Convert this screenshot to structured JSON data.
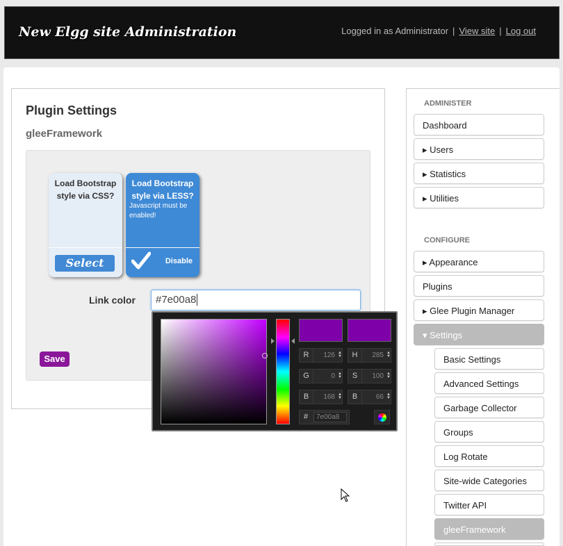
{
  "header": {
    "site_title": "New Elgg site Administration",
    "logged_in_text": "Logged in as Administrator",
    "separator": "|",
    "view_site": "View site",
    "logout": "Log out"
  },
  "main": {
    "title": "Plugin Settings",
    "plugin_name": "gleeFramework",
    "option_css": {
      "title": "Load Bootstrap style via CSS?",
      "button": "Select"
    },
    "option_less": {
      "title": "Load Bootstrap style via LESS?",
      "note": "Javascript must be enabled!",
      "button": "Disable"
    },
    "link_color_label": "Link color",
    "link_color_value": "#7e00a8",
    "save_label": "Save"
  },
  "color_picker": {
    "new_color": "#7e00a8",
    "current_color": "#7e00a8",
    "fields": {
      "r": {
        "label": "R",
        "value": "126"
      },
      "g": {
        "label": "G",
        "value": "0"
      },
      "b": {
        "label": "B",
        "value": "168"
      },
      "h": {
        "label": "H",
        "value": "285"
      },
      "s": {
        "label": "S",
        "value": "100"
      },
      "br": {
        "label": "B",
        "value": "66"
      }
    },
    "hex_label": "#",
    "hex_value": "7e00a8"
  },
  "sidebar": {
    "administer_heading": "ADMINISTER",
    "administer_items": [
      {
        "label": "Dashboard"
      },
      {
        "label": "▸ Users"
      },
      {
        "label": "▸ Statistics"
      },
      {
        "label": "▸ Utilities"
      }
    ],
    "configure_heading": "CONFIGURE",
    "configure_items": [
      {
        "label": "▸ Appearance"
      },
      {
        "label": "Plugins"
      },
      {
        "label": "▸ Glee Plugin Manager"
      },
      {
        "label": "▾ Settings",
        "active": true
      }
    ],
    "settings_items": [
      {
        "label": "Basic Settings"
      },
      {
        "label": "Advanced Settings"
      },
      {
        "label": "Garbage Collector"
      },
      {
        "label": "Groups"
      },
      {
        "label": "Log Rotate"
      },
      {
        "label": "Site-wide Categories"
      },
      {
        "label": "Twitter API"
      },
      {
        "label": "gleeFramework",
        "active": true
      }
    ]
  },
  "colors": {
    "accent_purple": "#8a169a",
    "selected_blue": "#3f8ad6",
    "active_sidebar": "#bbbbbb"
  }
}
